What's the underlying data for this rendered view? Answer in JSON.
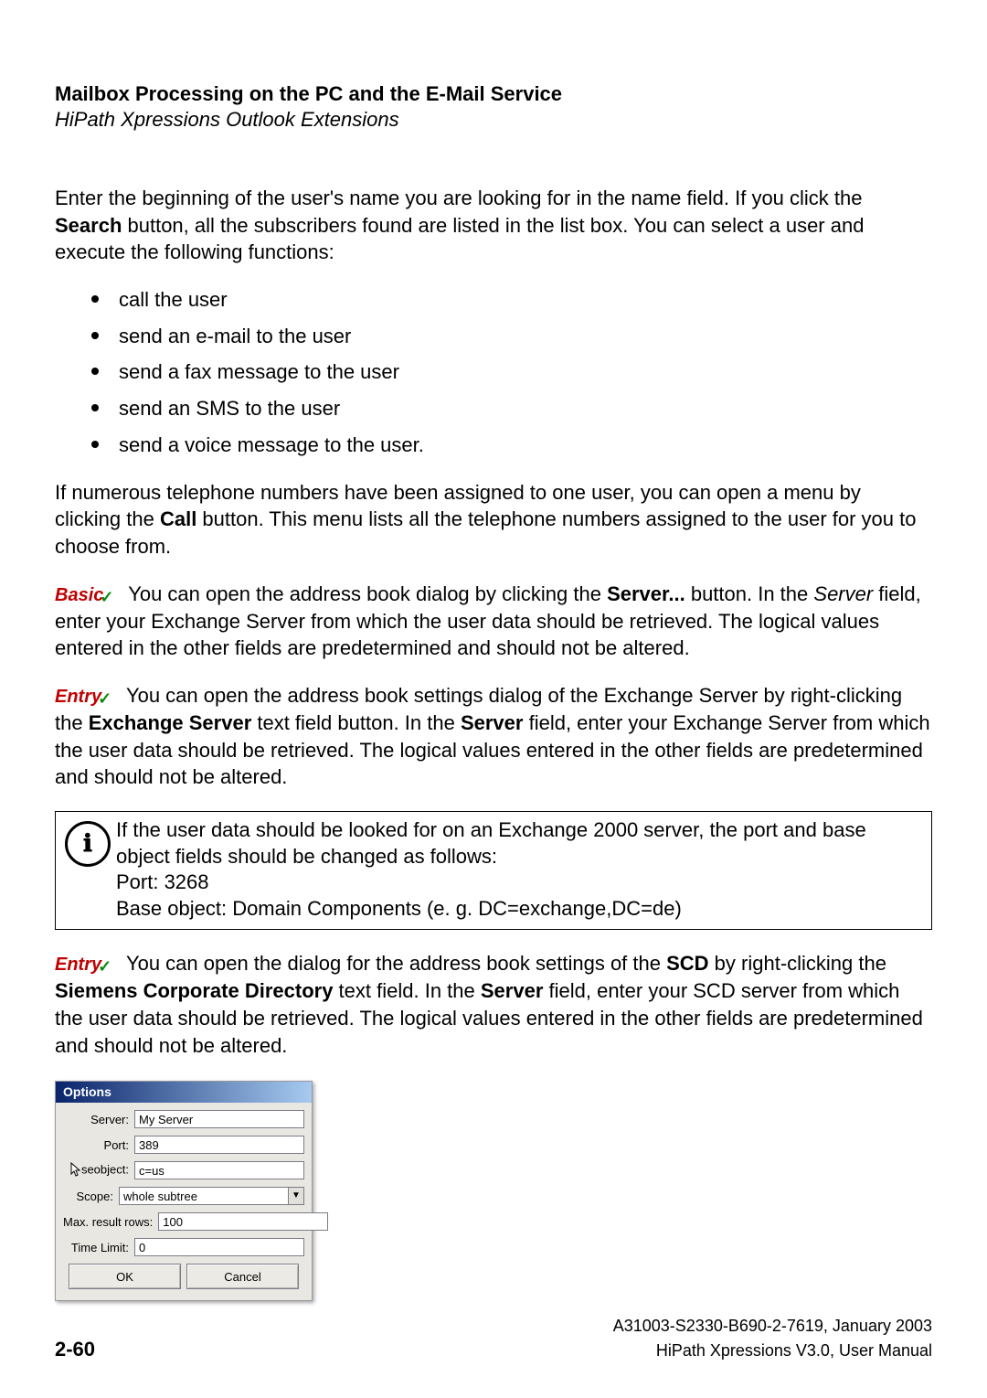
{
  "header": {
    "title": "Mailbox Processing on the PC and the E-Mail Service",
    "subtitle": "HiPath Xpressions Outlook Extensions"
  },
  "intro_parts": [
    "Enter the beginning of the user's name you are looking for in the name field. If you click the ",
    "Search",
    " button, all the subscribers found are listed in the list box. You can select a user and execute the following functions:"
  ],
  "bullets": [
    "call the user",
    "send an e-mail to the user",
    "send a fax message to the user",
    "send an SMS to the user",
    "send a voice message to the user."
  ],
  "para_call": [
    "If numerous telephone numbers have been assigned to one user, you can open a menu by clicking the ",
    "Call",
    " button. This menu lists all the telephone numbers assigned to the user for you to choose from."
  ],
  "tag_basic": "Basic",
  "para_basic": [
    "You can open the address book dialog by clicking the ",
    "Server...",
    " button. In the ",
    "Server",
    " field, enter your Exchange Server from which the user data should be retrieved. The logical values entered in the other fields are predetermined and should not be altered."
  ],
  "tag_entry": "Entry",
  "para_entry1": [
    "You can open the address book settings dialog of the Exchange Server by right-clicking the ",
    "Exchange Server",
    " text field button. In the ",
    "Server",
    " field, enter your Exchange Server from which the user data should be retrieved. The logical values entered in the other fields are predetermined and should not be altered."
  ],
  "note": {
    "line1": "If the user data should be looked for on an Exchange 2000 server, the port and base object fields should be changed as follows:",
    "line2": "Port: 3268",
    "line3": "Base object: Domain Components (e. g. DC=exchange,DC=de)"
  },
  "para_entry2": [
    "You can open the dialog for the address book settings of the ",
    "SCD",
    " by right-clicking the ",
    "Siemens Corporate Directory",
    " text field. In the ",
    "Server",
    " field, enter your SCD server from which the user data should be retrieved. The logical values entered in the other fields are predetermined and should not be altered."
  ],
  "dialog": {
    "title": "Options",
    "fields": {
      "server": {
        "label": "Server:",
        "value": "My Server"
      },
      "port": {
        "label": "Port:",
        "value": "389"
      },
      "base": {
        "label": "seobject:",
        "value": "c=us"
      },
      "scope": {
        "label": "Scope:",
        "value": "whole subtree"
      },
      "maxrows": {
        "label": "Max. result rows:",
        "value": "100"
      },
      "timelimit": {
        "label": "Time Limit:",
        "value": "0"
      }
    },
    "ok": "OK",
    "cancel": "Cancel"
  },
  "footer": {
    "ref": "A31003-S2330-B690-2-7619, January 2003",
    "manual": "HiPath Xpressions V3.0, User Manual",
    "page": "2-60"
  }
}
